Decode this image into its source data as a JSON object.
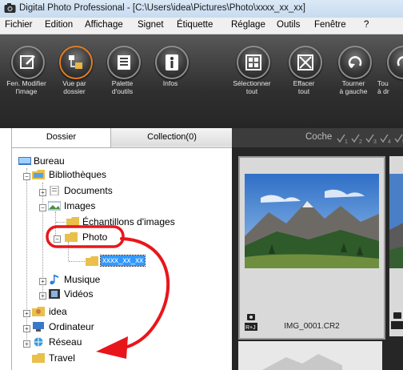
{
  "window": {
    "title": "Digital Photo Professional - [C:\\Users\\idea\\Pictures\\Photo\\xxxx_xx_xx]"
  },
  "menu": [
    "Fichier",
    "Edition",
    "Affichage",
    "Signet",
    "Étiquette",
    "Réglage",
    "Outils",
    "Fenêtre",
    "?"
  ],
  "toolbar": {
    "buttons": [
      {
        "label1": "Fen. Modifier",
        "label2": "l'image",
        "icon": "edit-image-icon"
      },
      {
        "label1": "Vue par",
        "label2": "dossier",
        "icon": "folder-view-icon"
      },
      {
        "label1": "Palette",
        "label2": "d'outils",
        "icon": "tool-palette-icon"
      },
      {
        "label1": "Infos",
        "label2": "",
        "icon": "info-icon"
      },
      {
        "label1": "Sélectionner",
        "label2": "tout",
        "icon": "select-all-icon"
      },
      {
        "label1": "Effacer",
        "label2": "tout",
        "icon": "clear-all-icon"
      },
      {
        "label1": "Tourner",
        "label2": "à gauche",
        "icon": "rotate-left-icon"
      },
      {
        "label1": "Tou",
        "label2": "à dr",
        "icon": "rotate-right-icon"
      }
    ]
  },
  "tabs": {
    "folder": "Dossier",
    "collection": "Collection(0)"
  },
  "tree": {
    "bureau": "Bureau",
    "bibliotheques": "Bibliothèques",
    "documents": "Documents",
    "images": "Images",
    "echantillons": "Échantillons d'images",
    "photo": "Photo",
    "selected": "xxxx_xx_xx",
    "musique": "Musique",
    "videos": "Vidéos",
    "idea": "idea",
    "ordinateur": "Ordinateur",
    "reseau": "Réseau",
    "travel": "Travel"
  },
  "filter": {
    "label": "Coche"
  },
  "thumbnail": {
    "filename": "IMG_0001.CR2",
    "badge": "R+J"
  },
  "colors": {
    "annotation": "#e8161b",
    "accent": "#e07b22",
    "selection": "#3399ff"
  }
}
